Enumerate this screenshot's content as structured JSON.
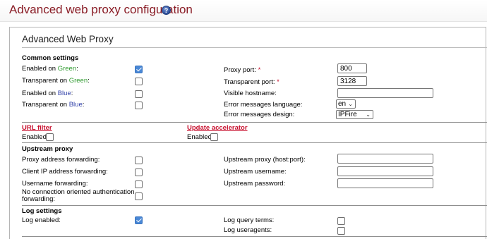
{
  "page": {
    "title": "Advanced web proxy configuration",
    "help_icon": "question-circle-icon"
  },
  "panel": {
    "title": "Advanced Web Proxy"
  },
  "common": {
    "heading": "Common settings",
    "enabled_on": "Enabled on ",
    "transparent_on": "Transparent on ",
    "green": "Green",
    "blue": "Blue",
    "colon": ":",
    "enabled_green_checked": true,
    "transparent_green_checked": false,
    "enabled_blue_checked": false,
    "transparent_blue_checked": false,
    "proxy_port_label": "Proxy port:",
    "proxy_port_value": "800",
    "transparent_port_label": "Transparent port:",
    "transparent_port_value": "3128",
    "required_mark": "*",
    "visible_hostname_label": "Visible hostname:",
    "visible_hostname_value": "",
    "error_lang_label": "Error messages language:",
    "error_lang_value": "en",
    "error_design_label": "Error messages design:",
    "error_design_value": "IPFire"
  },
  "url_filter": {
    "title": "URL filter",
    "enabled_label": "Enabled",
    "checked": false
  },
  "update_accelerator": {
    "title": "Update accelerator",
    "enabled_label": "Enabled",
    "checked": false
  },
  "upstream": {
    "heading": "Upstream proxy",
    "proxy_address_forwarding": "Proxy address forwarding:",
    "client_ip_forwarding": "Client IP address forwarding:",
    "username_forwarding": "Username forwarding:",
    "no_conn_auth_line1": "No connection oriented authentication",
    "no_conn_auth_line2": "forwarding:",
    "upstream_proxy_label": "Upstream proxy (host:port):",
    "upstream_username_label": "Upstream username:",
    "upstream_password_label": "Upstream password:",
    "upstream_proxy_value": "",
    "upstream_username_value": "",
    "upstream_password_value": ""
  },
  "log": {
    "heading": "Log settings",
    "log_enabled_label": "Log enabled:",
    "log_enabled_checked": true,
    "log_query_terms_label": "Log query terms:",
    "log_query_terms_checked": false,
    "log_useragents_label": "Log useragents:",
    "log_useragents_checked": false
  },
  "colors": {
    "title": "#8a1d26",
    "green": "#2e9a2e",
    "blue": "#2f3fa8",
    "link": "#c8102e",
    "checkbox_checked": "#4a88d6"
  }
}
